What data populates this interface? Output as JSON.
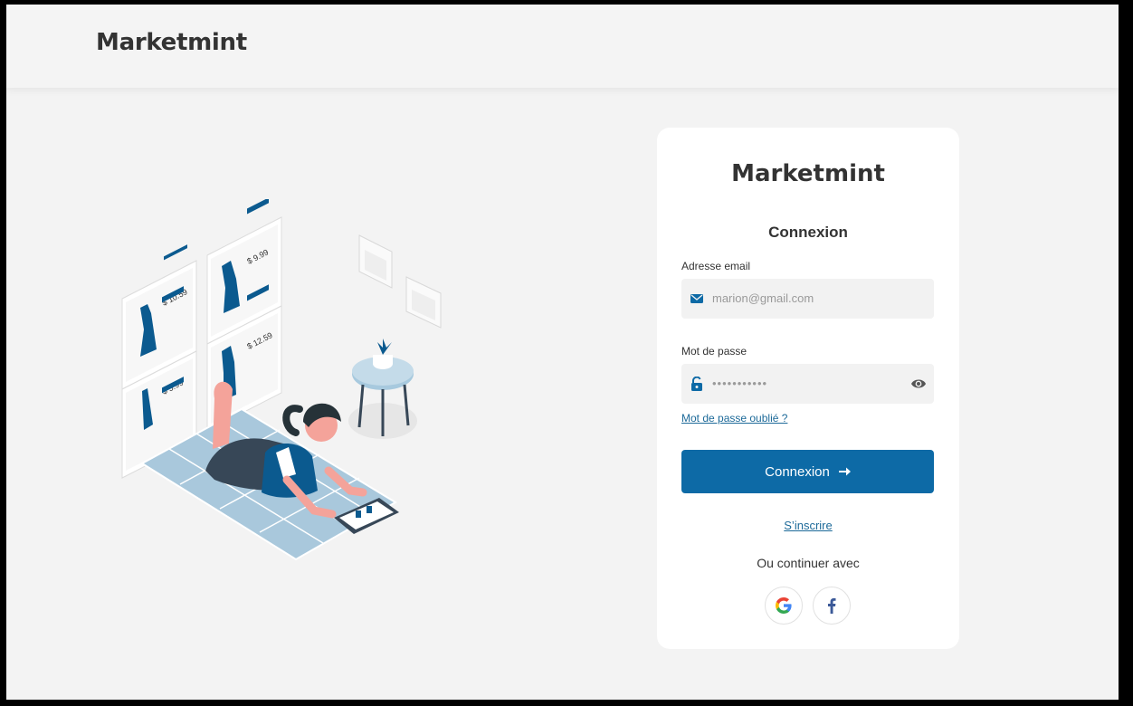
{
  "header": {
    "brand": "Marketmint"
  },
  "card": {
    "brand": "Marketmint",
    "title": "Connexion",
    "email": {
      "label": "Adresse email",
      "value": "marion@gmail.com",
      "icon": "mail-icon"
    },
    "password": {
      "label": "Mot de passe",
      "value": "•••••••••••",
      "icon": "unlock-icon",
      "toggle_icon": "eye-icon"
    },
    "forgot_link": "Mot de passe oublié ?",
    "login_button": "Connexion",
    "signup_link": "S’inscrire",
    "or_text": "Ou continuer avec",
    "social": [
      {
        "name": "google",
        "icon": "google-icon"
      },
      {
        "name": "facebook",
        "icon": "facebook-icon"
      }
    ]
  },
  "illustration": {
    "prices": [
      "$ 10.59",
      "$ 9.99",
      "$ 5.99",
      "$ 12.59"
    ]
  },
  "colors": {
    "primary": "#0d6aa6",
    "link": "#1d6a99",
    "background": "#f3f3f3",
    "dress": "#0b5a8f"
  }
}
